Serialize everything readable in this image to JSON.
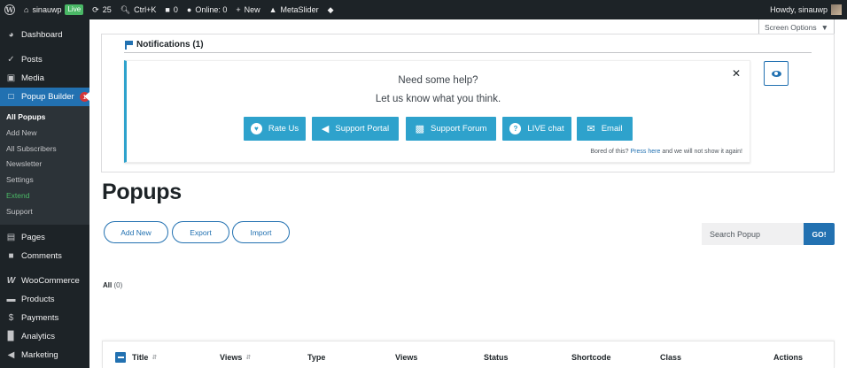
{
  "adminbar": {
    "site_name": "sinauwp",
    "live_label": "Live",
    "updates_count": "25",
    "search_shortcut": "Ctrl+K",
    "comments_count": "0",
    "online_label": "Online: 0",
    "new_label": "New",
    "metaslider_label": "MetaSlider",
    "greeting": "Howdy, sinauwp"
  },
  "sidebar": {
    "dashboard": "Dashboard",
    "posts": "Posts",
    "media": "Media",
    "popup_builder": "Popup Builder",
    "popup_builder_badge": "1",
    "submenu": {
      "all_popups": "All Popups",
      "add_new": "Add New",
      "all_subscribers": "All Subscribers",
      "newsletter": "Newsletter",
      "settings": "Settings",
      "extend": "Extend",
      "support": "Support"
    },
    "pages": "Pages",
    "comments": "Comments",
    "woocommerce": "WooCommerce",
    "products": "Products",
    "payments": "Payments",
    "analytics": "Analytics",
    "marketing": "Marketing"
  },
  "screen_options": "Screen Options",
  "notifications": {
    "title": "Notifications (1)",
    "help_question": "Need some help?",
    "help_subtitle": "Let us know what you think.",
    "buttons": {
      "rate_us": "Rate Us",
      "support_portal": "Support Portal",
      "support_forum": "Support Forum",
      "live_chat": "LIVE chat",
      "email": "Email"
    },
    "footer_prefix": "Bored of this?",
    "footer_link": "Press here",
    "footer_suffix": "and we will not show it again!"
  },
  "page": {
    "title": "Popups",
    "add_new": "Add New",
    "export": "Export",
    "import": "Import",
    "search_placeholder": "Search Popup",
    "go": "GO!",
    "filter_all": "All",
    "filter_all_count": "(0)"
  },
  "table": {
    "columns": {
      "title": "Title",
      "views_sortable": "Views",
      "type": "Type",
      "views": "Views",
      "status": "Status",
      "shortcode": "Shortcode",
      "class": "Class",
      "actions": "Actions"
    }
  },
  "icons": {
    "wordpress": "wordpress-logo-icon",
    "home": "home-icon",
    "updates": "updates-icon",
    "search": "search-icon",
    "comments": "comment-bubble-icon",
    "online": "online-icon",
    "new": "plus-icon",
    "metaslider": "metaslider-icon",
    "diamond": "diamond-icon"
  },
  "colors": {
    "admin_dark": "#1d2327",
    "accent_blue": "#2271b1",
    "help_button": "#2ea2cc",
    "live_green": "#4ab866",
    "badge_red": "#d63638"
  }
}
